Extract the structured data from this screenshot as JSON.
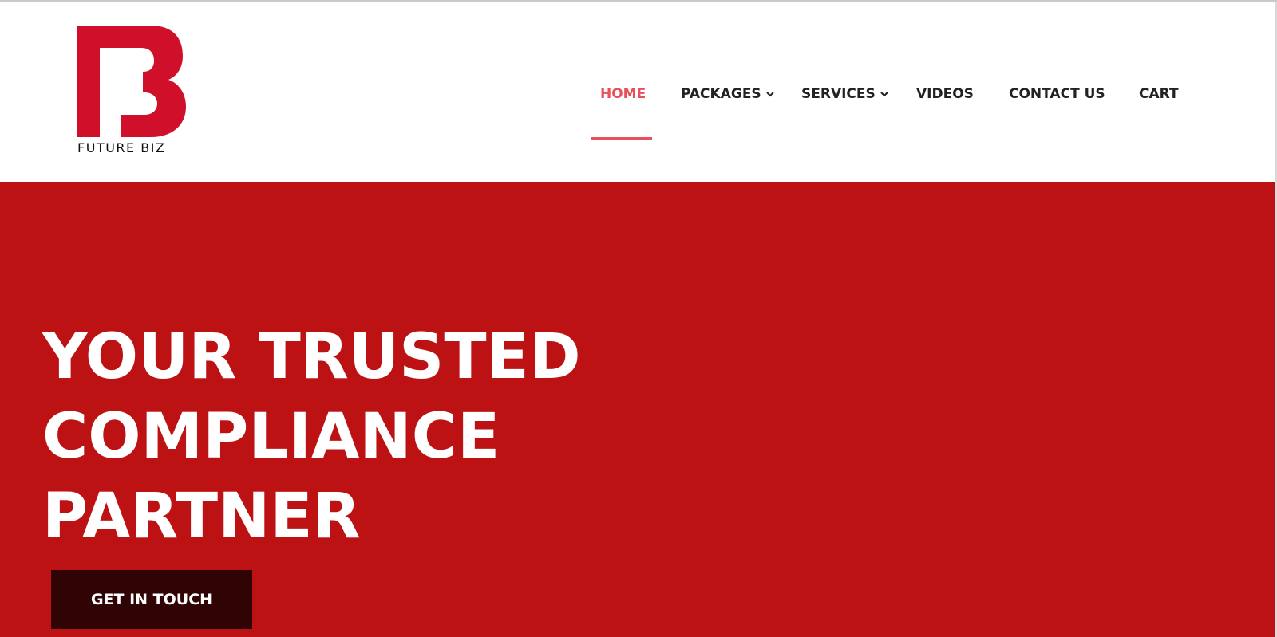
{
  "brand": {
    "name": "FUTURE BIZ",
    "accent": "#d0102a"
  },
  "nav": {
    "items": [
      {
        "label": "HOME",
        "active": true
      },
      {
        "label": "PACKAGES",
        "dropdown": true
      },
      {
        "label": "SERVICES",
        "dropdown": true
      },
      {
        "label": "VIDEOS"
      },
      {
        "label": "CONTACT US"
      },
      {
        "label": "CART"
      }
    ],
    "active_color": "#e8505b",
    "text_color": "#222222"
  },
  "hero": {
    "title_lines": [
      "YOUR TRUSTED",
      "COMPLIANCE",
      "PARTNER"
    ],
    "cta_label": "GET IN TOUCH",
    "background": "#bd1213",
    "cta_background": "#300304"
  },
  "icons": {
    "dropdown": "chevron-down-icon",
    "logo": "future-biz-logo"
  }
}
